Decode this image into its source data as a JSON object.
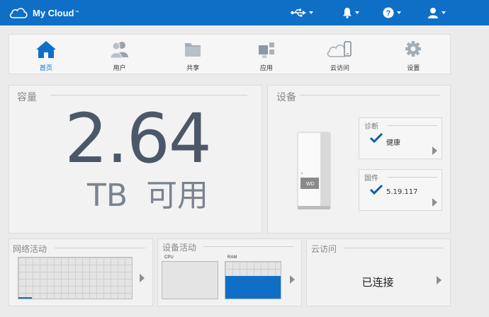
{
  "app": {
    "title": "My Cloud",
    "trademark": "™"
  },
  "topbar": {
    "icons": [
      "usb-icon",
      "bell-icon",
      "help-icon",
      "user-icon"
    ]
  },
  "nav": {
    "items": [
      {
        "label": "首页",
        "icon": "home-icon",
        "active": true
      },
      {
        "label": "用户",
        "icon": "users-icon",
        "active": false
      },
      {
        "label": "共享",
        "icon": "folder-icon",
        "active": false
      },
      {
        "label": "应用",
        "icon": "apps-icon",
        "active": false
      },
      {
        "label": "云访问",
        "icon": "cloud-access-icon",
        "active": false
      },
      {
        "label": "设置",
        "icon": "gear-icon",
        "active": false
      }
    ]
  },
  "capacity": {
    "title": "容量",
    "value": "2.64",
    "unit": "TB",
    "suffix": "可用"
  },
  "device": {
    "title": "设备",
    "diagnostics": {
      "title": "诊断",
      "value": "健康"
    },
    "firmware": {
      "title": "固件",
      "value": "5.19.117"
    }
  },
  "network": {
    "title": "网络活动",
    "activity_fraction": 0.12
  },
  "device_activity": {
    "title": "设备活动",
    "cpu_label": "CPU",
    "ram_label": "RAM",
    "cpu_fraction": 0.0,
    "ram_fraction": 0.62
  },
  "cloud": {
    "title": "云访问",
    "status": "已连接"
  },
  "colors": {
    "brand": "#0f6fc6",
    "text_dark": "#4c5868",
    "ram_fill": "#0f6fc6"
  }
}
